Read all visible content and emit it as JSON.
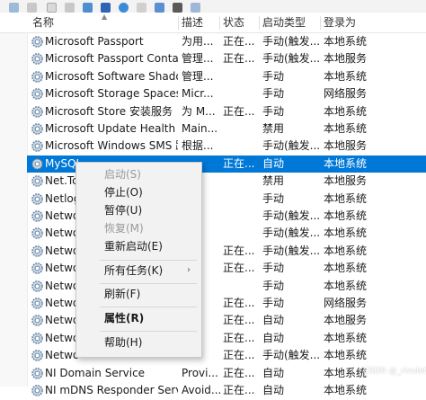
{
  "header": {
    "name": "名称",
    "description": "描述",
    "status": "状态",
    "startup_type": "启动类型",
    "logon_as": "登录为"
  },
  "rows": [
    {
      "name": "Microsoft Passport",
      "desc": "为用...",
      "status": "正在...",
      "start": "手动(触发...",
      "logon": "本地系统"
    },
    {
      "name": "Microsoft Passport Container",
      "desc": "管理...",
      "status": "正在...",
      "start": "手动(触发...",
      "logon": "本地服务"
    },
    {
      "name": "Microsoft Software Shado...",
      "desc": "管理...",
      "status": "",
      "start": "手动",
      "logon": "本地系统"
    },
    {
      "name": "Microsoft Storage Spaces S...",
      "desc": "Micr...",
      "status": "",
      "start": "手动",
      "logon": "网络服务"
    },
    {
      "name": "Microsoft Store 安装服务",
      "desc": "为 M...",
      "status": "正在...",
      "start": "手动",
      "logon": "本地系统"
    },
    {
      "name": "Microsoft Update Health S...",
      "desc": "Main...",
      "status": "",
      "start": "禁用",
      "logon": "本地系统"
    },
    {
      "name": "Microsoft Windows SMS 路...",
      "desc": "根据...",
      "status": "",
      "start": "手动(触发...",
      "logon": "本地服务"
    },
    {
      "name": "MySQL",
      "desc": "",
      "status": "正在...",
      "start": "自动",
      "logon": "本地系统"
    },
    {
      "name": "Net.Tc",
      "desc": "",
      "status": "",
      "start": "禁用",
      "logon": "本地服务"
    },
    {
      "name": "Netlog",
      "desc": "",
      "status": "",
      "start": "手动",
      "logon": "本地系统"
    },
    {
      "name": "Netwo",
      "desc": "",
      "status": "",
      "start": "手动(触发...",
      "logon": "本地系统"
    },
    {
      "name": "Netwo",
      "desc": "",
      "status": "",
      "start": "手动(触发...",
      "logon": "本地系统"
    },
    {
      "name": "Netwo",
      "desc": "",
      "status": "正在...",
      "start": "手动(触发...",
      "logon": "本地系统"
    },
    {
      "name": "Netwo",
      "desc": "",
      "status": "正在...",
      "start": "手动",
      "logon": "本地系统"
    },
    {
      "name": "Netwo",
      "desc": "",
      "status": "",
      "start": "手动",
      "logon": "本地系统"
    },
    {
      "name": "Netwo",
      "desc": "",
      "status": "正在...",
      "start": "手动",
      "logon": "网络服务"
    },
    {
      "name": "Netwo",
      "desc": "",
      "status": "正在...",
      "start": "自动",
      "logon": "本地服务"
    },
    {
      "name": "Netwo",
      "desc": "",
      "status": "正在...",
      "start": "自动",
      "logon": "本地系统"
    },
    {
      "name": "Netwo",
      "desc": "",
      "status": "正在...",
      "start": "手动(触发...",
      "logon": "本地系统"
    },
    {
      "name": "NI Domain Service",
      "desc": "Provi...",
      "status": "正在...",
      "start": "自动",
      "logon": "本地系统"
    },
    {
      "name": "NI mDNS Responder Servi...",
      "desc": "Avoid...",
      "status": "正在...",
      "start": "自动",
      "logon": "本地系统"
    }
  ],
  "selected_row_index": 7,
  "context_menu": {
    "items": [
      {
        "label": "启动(S)",
        "enabled": false
      },
      {
        "label": "停止(O)",
        "enabled": true
      },
      {
        "label": "暂停(U)",
        "enabled": true
      },
      {
        "label": "恢复(M)",
        "enabled": false
      },
      {
        "label": "重新启动(E)",
        "enabled": true
      },
      {
        "label": "所有任务(K)",
        "enabled": true,
        "submenu": true
      },
      {
        "label": "刷新(F)",
        "enabled": true
      },
      {
        "label": "属性(R)",
        "enabled": true,
        "bold": true
      },
      {
        "label": "帮助(H)",
        "enabled": true
      }
    ],
    "submenu_glyph": "›"
  },
  "watermark": "CSDN @_rivulet",
  "colors": {
    "selection": "#0078d7",
    "menu_bg": "#f2f2f2",
    "disabled_text": "#9a9a9a"
  },
  "icons": {
    "row_icon": "service-gear-icon",
    "sort_icon": "sort-ascending-icon"
  }
}
